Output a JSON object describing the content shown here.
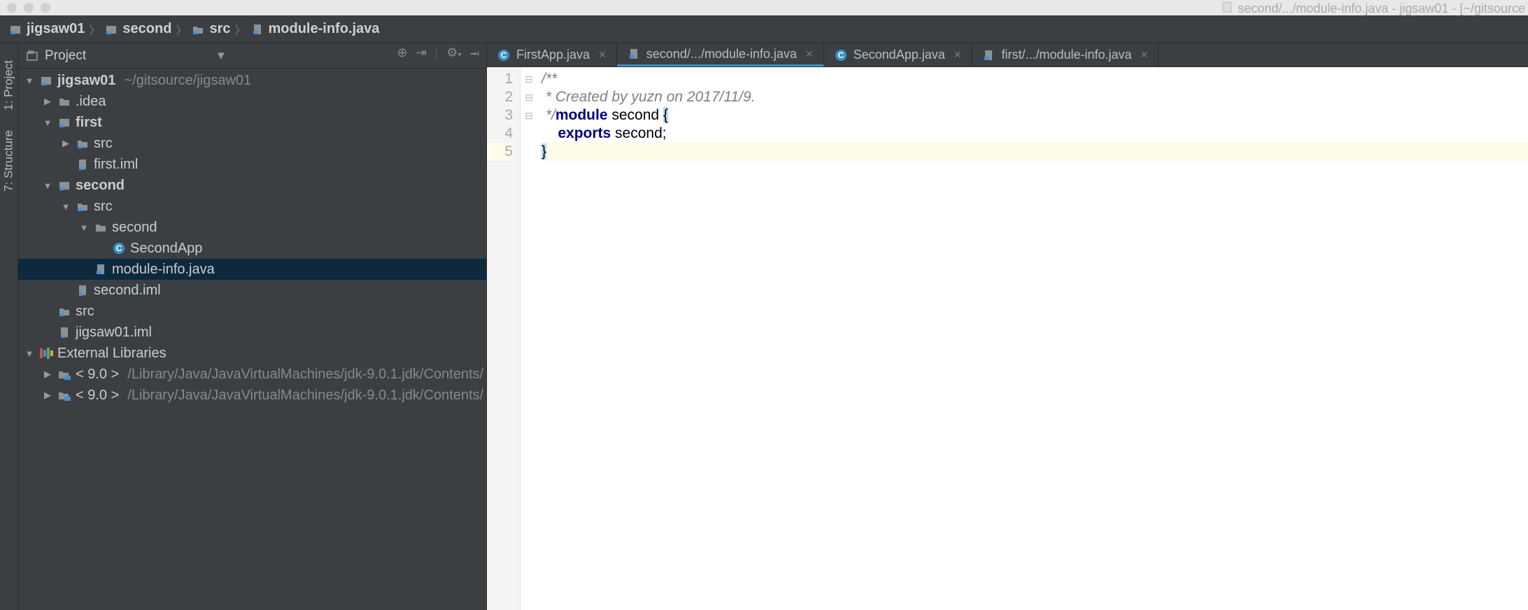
{
  "titlebar": {
    "center": "second/.../module-info.java - jigsaw01 - [~/gitsource",
    "dots": 3
  },
  "breadcrumbs": [
    {
      "icon": "module",
      "label": "jigsaw01"
    },
    {
      "icon": "module",
      "label": "second"
    },
    {
      "icon": "folder-blue",
      "label": "src"
    },
    {
      "icon": "java",
      "label": "module-info.java"
    }
  ],
  "side_tabs": [
    {
      "label": "1: Project"
    },
    {
      "label": "7: Structure"
    }
  ],
  "panel": {
    "title": "Project",
    "tools": [
      "target",
      "align",
      "gear",
      "collapse"
    ]
  },
  "tree": [
    {
      "d": 0,
      "exp": "▼",
      "icon": "module",
      "label": "jigsaw01",
      "bold": true,
      "trail": "~/gitsource/jigsaw01"
    },
    {
      "d": 1,
      "exp": "▶",
      "icon": "folder",
      "label": ".idea"
    },
    {
      "d": 1,
      "exp": "▼",
      "icon": "module",
      "label": "first",
      "bold": true
    },
    {
      "d": 2,
      "exp": "▶",
      "icon": "folder-blue",
      "label": "src"
    },
    {
      "d": 2,
      "exp": "",
      "icon": "file",
      "label": "first.iml"
    },
    {
      "d": 1,
      "exp": "▼",
      "icon": "module",
      "label": "second",
      "bold": true
    },
    {
      "d": 2,
      "exp": "▼",
      "icon": "folder-blue",
      "label": "src"
    },
    {
      "d": 3,
      "exp": "▼",
      "icon": "folder",
      "label": "second"
    },
    {
      "d": 4,
      "exp": "",
      "icon": "class",
      "label": "SecondApp"
    },
    {
      "d": 3,
      "exp": "",
      "icon": "java",
      "label": "module-info.java",
      "sel": true
    },
    {
      "d": 2,
      "exp": "",
      "icon": "file",
      "label": "second.iml"
    },
    {
      "d": 1,
      "exp": "",
      "icon": "folder-blue",
      "label": "src"
    },
    {
      "d": 1,
      "exp": "",
      "icon": "file",
      "label": "jigsaw01.iml"
    },
    {
      "d": 0,
      "exp": "▼",
      "icon": "libs",
      "label": "External Libraries"
    },
    {
      "d": 1,
      "exp": "▶",
      "icon": "lib",
      "label": "< 9.0 >",
      "trail": "/Library/Java/JavaVirtualMachines/jdk-9.0.1.jdk/Contents/"
    },
    {
      "d": 1,
      "exp": "▶",
      "icon": "lib",
      "label": "< 9.0 >",
      "trail": "/Library/Java/JavaVirtualMachines/jdk-9.0.1.jdk/Contents/"
    }
  ],
  "tabs": [
    {
      "icon": "class",
      "label": "FirstApp.java",
      "active": false
    },
    {
      "icon": "java",
      "label": "second/.../module-info.java",
      "active": true
    },
    {
      "icon": "class",
      "label": "SecondApp.java",
      "active": false
    },
    {
      "icon": "java",
      "label": "first/.../module-info.java",
      "active": false
    }
  ],
  "code": {
    "lines": [
      {
        "n": 1,
        "fold": "⊟",
        "seg": [
          {
            "t": "/**",
            "cls": "c-comment"
          }
        ]
      },
      {
        "n": 2,
        "fold": "",
        "seg": [
          {
            "t": " * Created by yuzn on 2017/11/9.",
            "cls": "c-comment"
          }
        ]
      },
      {
        "n": 3,
        "fold": "⊟",
        "seg": [
          {
            "t": " */",
            "cls": "c-comment"
          },
          {
            "t": "module",
            "cls": "c-kw"
          },
          {
            "t": " second ",
            "cls": ""
          },
          {
            "t": "{",
            "cls": "c-brace"
          }
        ]
      },
      {
        "n": 4,
        "fold": "",
        "seg": [
          {
            "t": "    ",
            "cls": ""
          },
          {
            "t": "exports",
            "cls": "c-kw"
          },
          {
            "t": " second;",
            "cls": ""
          }
        ]
      },
      {
        "n": 5,
        "fold": "⊟",
        "hl": true,
        "seg": [
          {
            "t": "}",
            "cls": "c-brace"
          }
        ]
      }
    ]
  }
}
